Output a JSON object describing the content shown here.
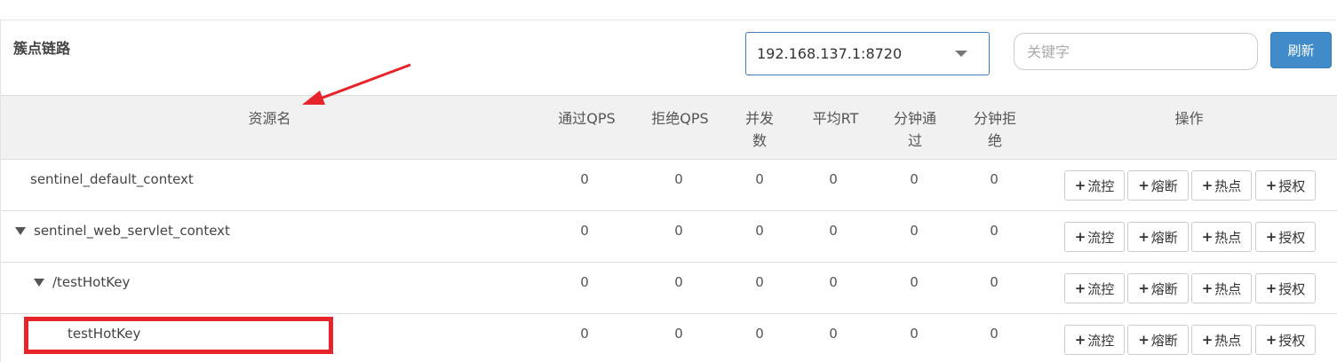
{
  "panel": {
    "title": "簇点链路",
    "machine_select": {
      "value": "192.168.137.1:8720"
    },
    "search": {
      "placeholder": "关键字",
      "value": ""
    },
    "refresh_label": "刷新"
  },
  "table": {
    "headers": {
      "resource": "资源名",
      "pass_qps": "通过QPS",
      "block_qps": "拒绝QPS",
      "concurrency_l1": "并发",
      "concurrency_l2": "数",
      "avg_rt": "平均RT",
      "min_pass_l1": "分钟通",
      "min_pass_l2": "过",
      "min_block_l1": "分钟拒",
      "min_block_l2": "绝",
      "actions": "操作"
    },
    "rows": [
      {
        "name": "sentinel_default_context",
        "expanded": null,
        "pass_qps": "0",
        "block_qps": "0",
        "concurrency": "0",
        "avg_rt": "0",
        "min_pass": "0",
        "min_block": "0"
      },
      {
        "name": "sentinel_web_servlet_context",
        "expanded": true,
        "pass_qps": "0",
        "block_qps": "0",
        "concurrency": "0",
        "avg_rt": "0",
        "min_pass": "0",
        "min_block": "0"
      },
      {
        "name": "/testHotKey",
        "expanded": true,
        "pass_qps": "0",
        "block_qps": "0",
        "concurrency": "0",
        "avg_rt": "0",
        "min_pass": "0",
        "min_block": "0"
      },
      {
        "name": "testHotKey",
        "expanded": null,
        "pass_qps": "0",
        "block_qps": "0",
        "concurrency": "0",
        "avg_rt": "0",
        "min_pass": "0",
        "min_block": "0"
      }
    ],
    "actions": {
      "flow": "流控",
      "degrade": "熔断",
      "hotspot": "热点",
      "authority": "授权",
      "plus_icon": "+"
    }
  },
  "annotation": {
    "arrow_color": "#e8242b",
    "box_color": "#e8242b"
  }
}
